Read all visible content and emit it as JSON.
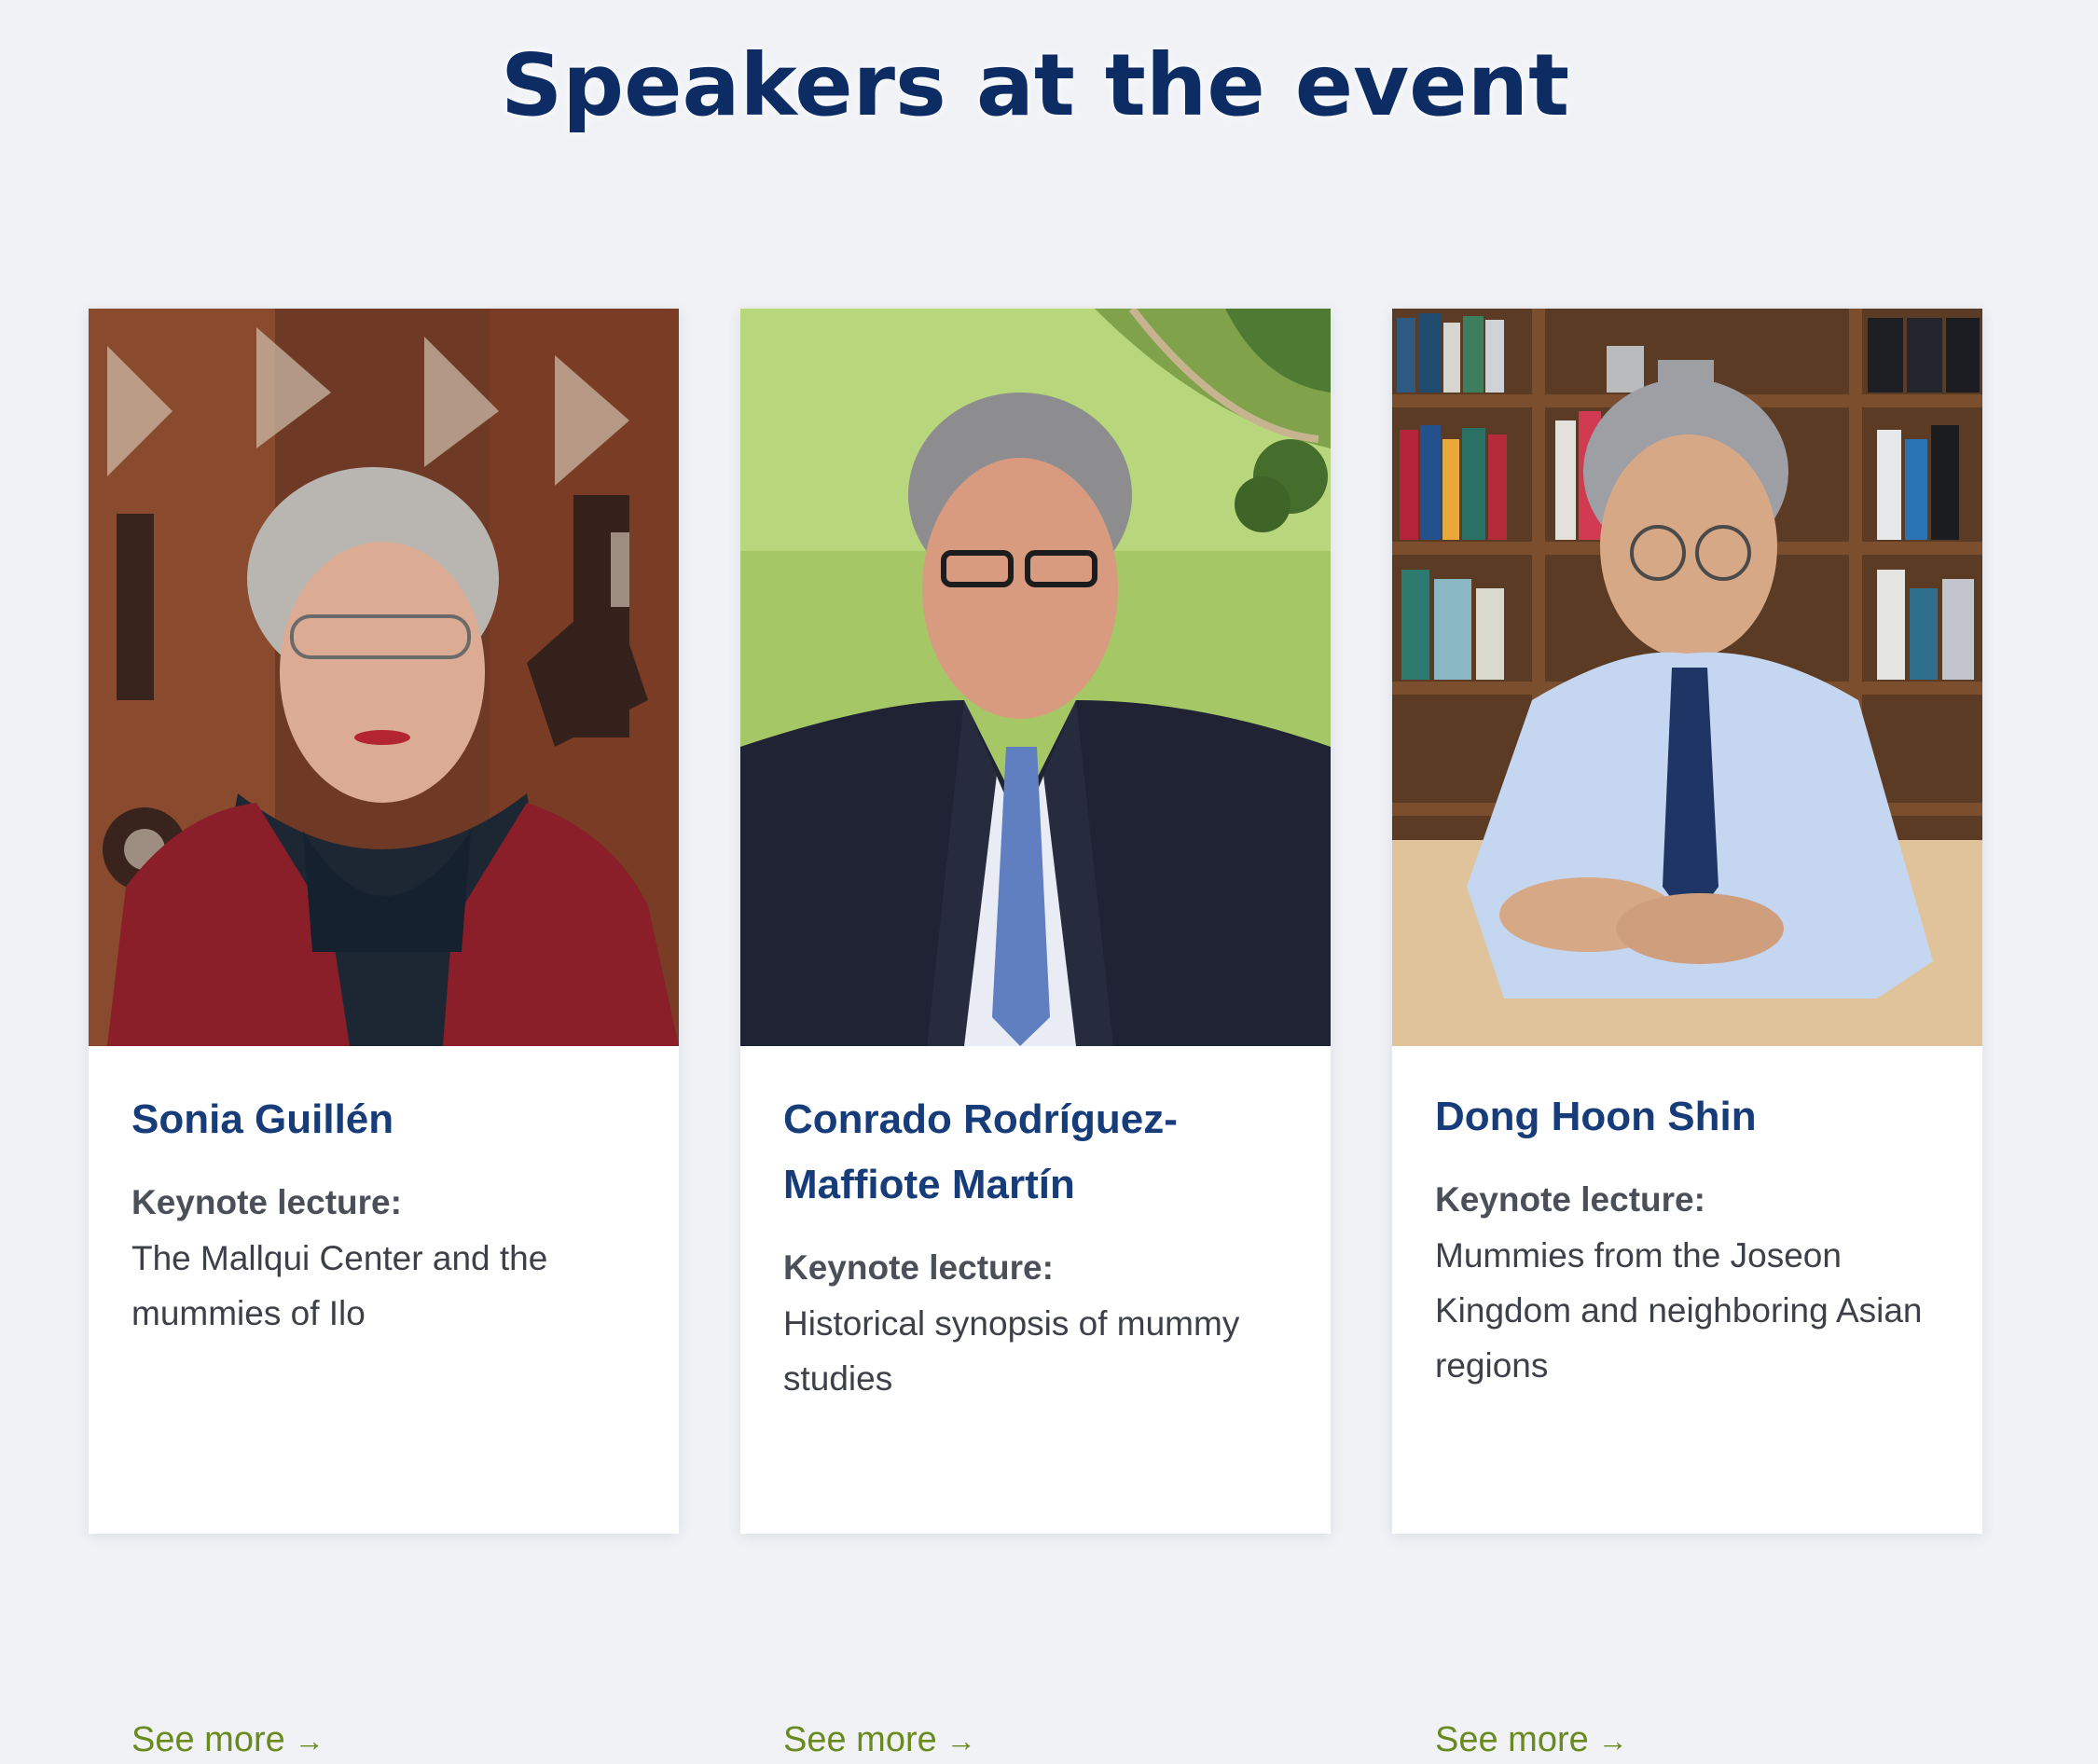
{
  "page": {
    "title": "Speakers at the event"
  },
  "speakers": [
    {
      "name": "Sonia Guillén",
      "lecture_label": "Keynote lecture:",
      "lecture_title": "The Mallqui Center and the mummies of Ilo",
      "link_label": "See more",
      "link_icon": "arrow-right-icon"
    },
    {
      "name": "Conrado Rodríguez-Maffiote Martín",
      "lecture_label": "Keynote lecture:",
      "lecture_title": "Historical synopsis of mummy studies",
      "link_label": "See more",
      "link_icon": "arrow-right-icon"
    },
    {
      "name": "Dong Hoon Shin",
      "lecture_label": "Keynote lecture:",
      "lecture_title": "Mummies from the Joseon Kingdom and neighboring Asian regions",
      "link_label": "See more",
      "link_icon": "arrow-right-icon"
    }
  ],
  "colors": {
    "title": "#0d2c63",
    "name": "#173c7a",
    "link": "#6a8a1f",
    "background": "#f0f2f6"
  }
}
